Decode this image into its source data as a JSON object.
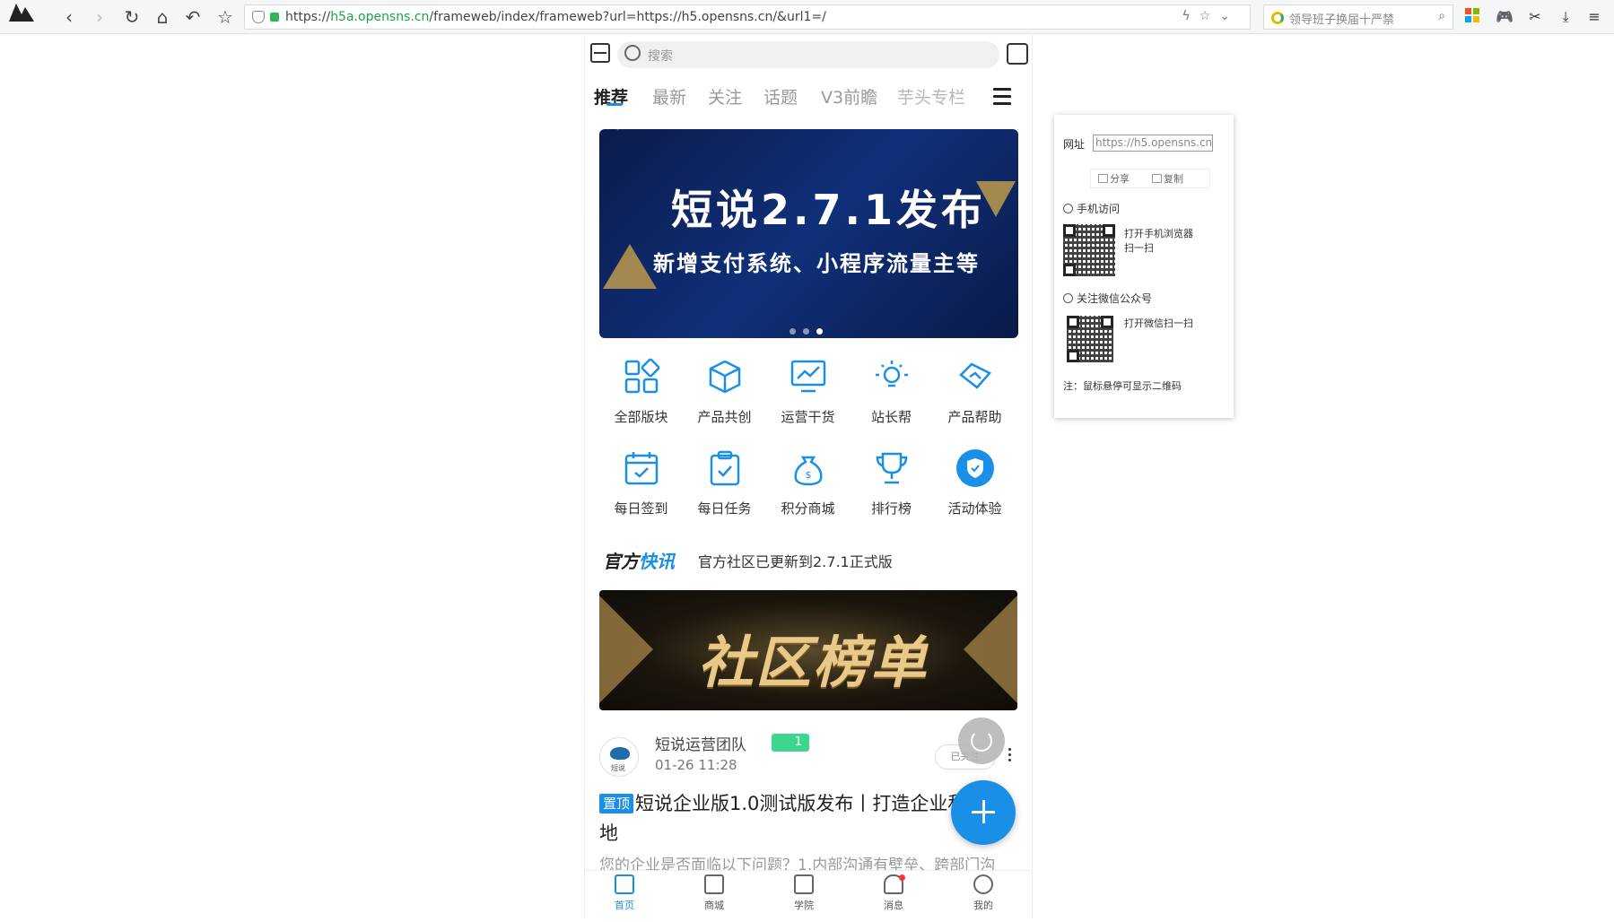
{
  "browser": {
    "url_prefix": "https://",
    "url_host": "h5a.opensns.cn",
    "url_rest": "/frameweb/index/frameweb?url=https://h5.opensns.cn/&url1=/",
    "search_text": "领导班子换届十严禁"
  },
  "app": {
    "search_placeholder": "搜索",
    "tabs": [
      {
        "label": "推荐",
        "active": true
      },
      {
        "label": "最新"
      },
      {
        "label": "关注"
      },
      {
        "label": "话题"
      },
      {
        "label": "V3前瞻"
      },
      {
        "label": "芋头专栏"
      }
    ],
    "banner": {
      "title": "短说2.7.1发布",
      "subtitle": "新增支付系统、小程序流量主等",
      "slide_count": 3,
      "active_slide": 3
    },
    "grid": [
      {
        "label": "全部版块",
        "icon": "blocks-icon"
      },
      {
        "label": "产品共创",
        "icon": "cube-icon"
      },
      {
        "label": "运营干货",
        "icon": "chart-monitor-icon"
      },
      {
        "label": "站长帮",
        "icon": "lightbulb-icon"
      },
      {
        "label": "产品帮助",
        "icon": "handshake-icon"
      },
      {
        "label": "每日签到",
        "icon": "calendar-check-icon"
      },
      {
        "label": "每日任务",
        "icon": "clipboard-check-icon"
      },
      {
        "label": "积分商城",
        "icon": "money-bag-icon"
      },
      {
        "label": "排行榜",
        "icon": "trophy-icon"
      },
      {
        "label": "活动体验",
        "icon": "shield-badge-icon"
      }
    ],
    "news": {
      "badge_a": "官方",
      "badge_b": "快讯",
      "text": "官方社区已更新到2.7.1正式版"
    },
    "rank_banner_text": "社区榜单",
    "post": {
      "avatar_text": "短说",
      "author": "短说运营团队",
      "level": "1",
      "date": "01-26 11:28",
      "follow_label": "已关注",
      "pin_label": "置顶",
      "title": "短说企业版1.0测试版发布丨打造企业私域阵地",
      "excerpt": "您的企业是否面临以下问题？1.内部沟通有壁垒、跨部门沟"
    },
    "bottom_nav": [
      {
        "label": "首页",
        "active": true
      },
      {
        "label": "商城"
      },
      {
        "label": "学院"
      },
      {
        "label": "消息"
      },
      {
        "label": "我的"
      }
    ]
  },
  "side_panel": {
    "url_label": "网址",
    "url_value": "https://h5.opensns.cn/",
    "share_label": "分享",
    "copy_label": "复制",
    "mobile_title": "手机访问",
    "mobile_hint_1": "打开手机浏览器",
    "mobile_hint_2": "扫一扫",
    "wechat_title": "关注微信公众号",
    "wechat_hint": "打开微信扫一扫",
    "note": "注：鼠标悬停可显示二维码"
  },
  "colors": {
    "accent": "#1a8fe8",
    "level_badge": "#3ed58e"
  }
}
